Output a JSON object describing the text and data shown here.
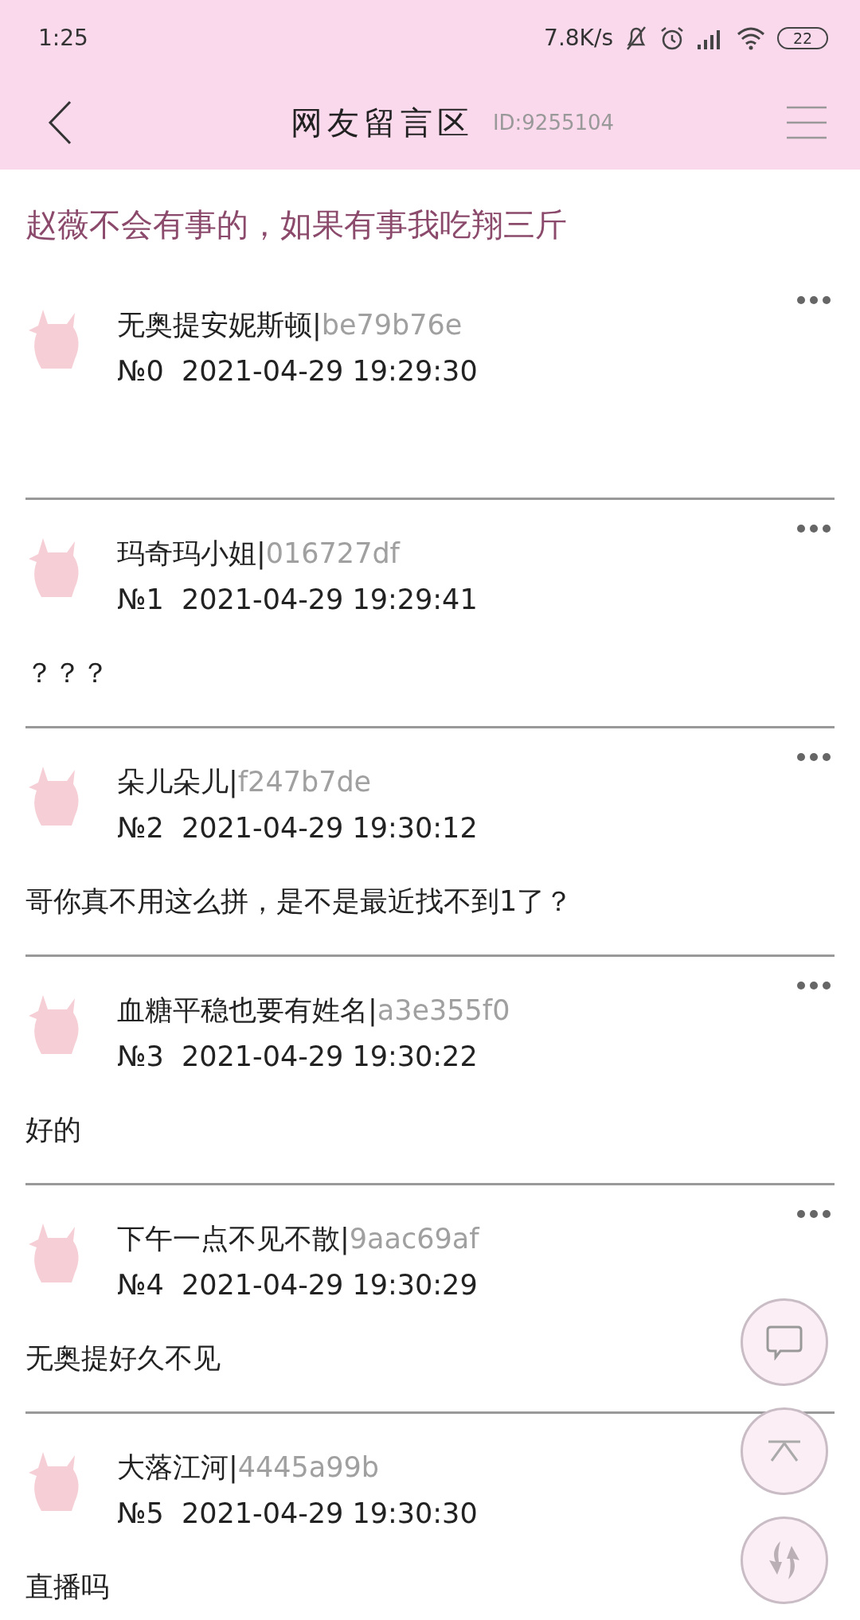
{
  "status_bar": {
    "time": "1:25",
    "speed": "7.8K/s",
    "battery": "22"
  },
  "header": {
    "title": "网友留言区",
    "id": "ID:9255104"
  },
  "topic": "赵薇不会有事的，如果有事我吃翔三斤",
  "posts": [
    {
      "name": "无奥提安妮斯顿|",
      "hash": "be79b76e",
      "number": "№0",
      "time": "2021-04-29 19:29:30",
      "menu_shown": true
    },
    {
      "name": "玛奇玛小姐|",
      "hash": "016727df",
      "number": "№1",
      "time": "2021-04-29 19:29:41",
      "body": "？？？",
      "menu_shown": true
    },
    {
      "name": "朵儿朵儿|",
      "hash": "f247b7de",
      "number": "№2",
      "time": "2021-04-29 19:30:12",
      "body": "哥你真不用这么拼，是不是最近找不到1了？",
      "menu_shown": true
    },
    {
      "name": "血糖平稳也要有姓名|",
      "hash": "a3e355f0",
      "number": "№3",
      "time": "2021-04-29 19:30:22",
      "body": "好的",
      "menu_shown": true
    },
    {
      "name": "下午一点不见不散|",
      "hash": "9aac69af",
      "number": "№4",
      "time": "2021-04-29 19:30:29",
      "body": "无奥提好久不见",
      "menu_shown": true
    },
    {
      "name": "大落江河|",
      "hash": "4445a99b",
      "number": "№5",
      "time": "2021-04-29 19:30:30",
      "body": "直播吗",
      "menu_shown": false
    }
  ]
}
